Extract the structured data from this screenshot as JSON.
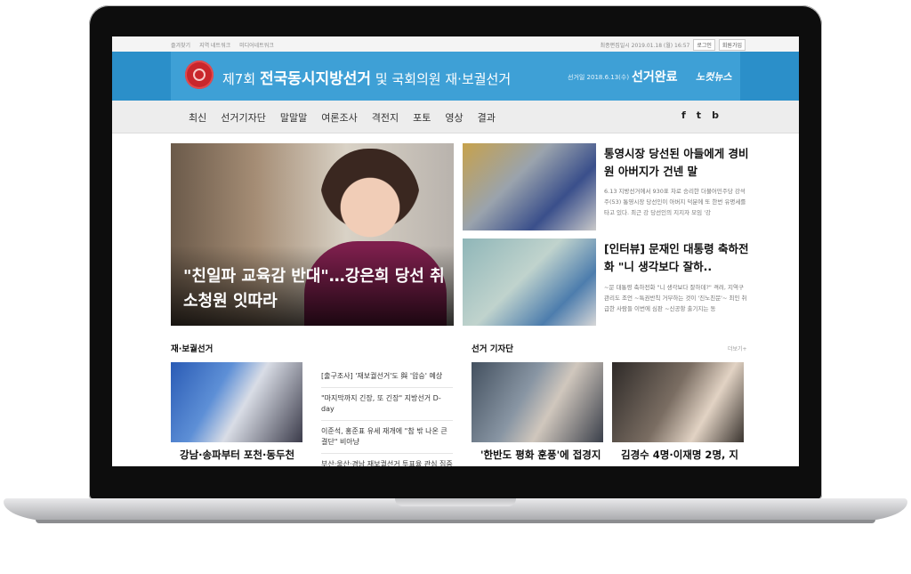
{
  "util": {
    "left_links": [
      "즐겨찾기",
      "지역 네트워크",
      "미디어네트워크"
    ],
    "timestamp": "최종편집일시 2019.01.18 (월) 16:57",
    "login": "로그인",
    "signup": "회원가입"
  },
  "banner": {
    "prefix": "제7회",
    "title_bold": "전국동시지방선거",
    "title_rest": "및 국회의원 재·보궐선거",
    "date": "선거일 2018.6.13(수)",
    "status": "선거완료",
    "brand": "노컷뉴스"
  },
  "nav": {
    "items": [
      "최신",
      "선거기자단",
      "말말말",
      "여론조사",
      "격전지",
      "포토",
      "영상",
      "결과"
    ],
    "social": [
      "f",
      "t",
      "b"
    ]
  },
  "hero": {
    "caption": "\"친일파 교육감 반대\"…강은희 당선 취소청원 잇따라"
  },
  "side_articles": [
    {
      "title": "통영시장 당선된 아들에게 경비원 아버지가 건넨 말",
      "snippet": "6.13 지방선거에서 930표 차로 승리한 더불어민주당 강석주(53) 통영시장 당선인이 아버지 덕분에 또 한번 유명세를 타고 있다. 최근 강 당선인의 지지자 모임 '강"
    },
    {
      "title": "[인터뷰] 문재인 대통령 축하전화 \"니 생각보다 잘하..",
      "snippet": "~문 대통령 축하전화 \"니 생각보다 잘하데?\" 격려, 지역구 관리도 조언 ~특권반칙 거부하는 것이 '진노친문'~ 최인 취급한 사람들 이번에 심판 ~신공항 출기지는 동"
    }
  ],
  "sections": {
    "byelection": "재·보궐선거",
    "reporters": "선거 기자단",
    "more": "더보기+"
  },
  "bottom": {
    "caption1": "강남·송파부터 포천·동두천",
    "caption2": "'한반도 평화 훈풍'에 접경지",
    "caption3": "김경수 4명·이재명 2명, 지"
  },
  "list_items": [
    "[출구조사] '재보궐선거'도 與 '압승' 예상",
    "\"마지막까지 긴장, 또 긴장\" 지방선거 D-day",
    "이준석, 홍준표 유세 재개에 \"참 밖 나온 큰 결단\" 비아냥",
    "부산·울산·경남 재보궐선거 투표율 관심 집중"
  ]
}
